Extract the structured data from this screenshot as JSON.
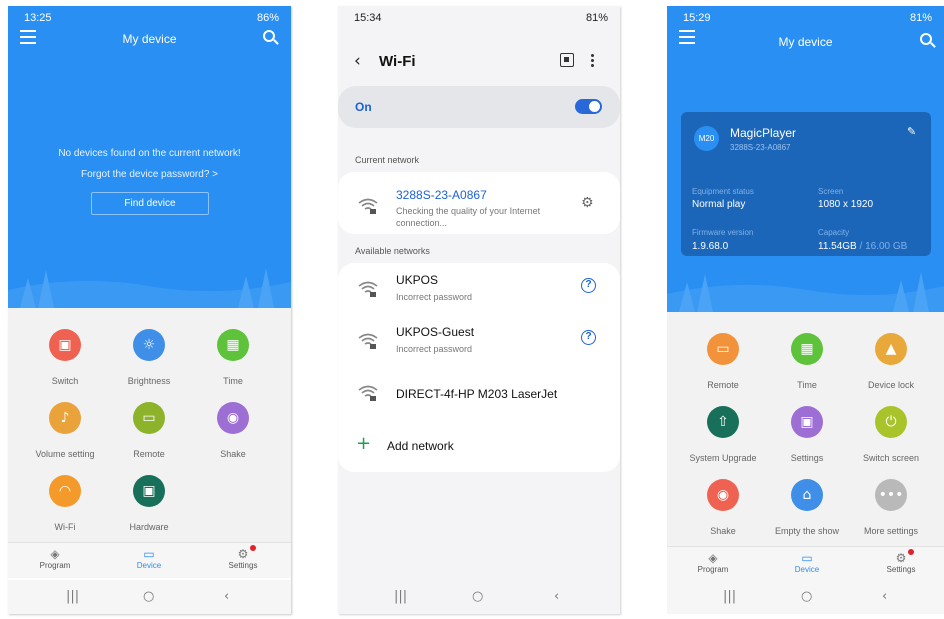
{
  "colors": {
    "accent": "#2a8ff2",
    "toggle": "#2868d8",
    "card": "#1c66b9",
    "badge": "#e0232b"
  },
  "phone1": {
    "status": {
      "time": "13:25",
      "battery": "86%"
    },
    "title": "My device",
    "message1": "No devices found on the current network!",
    "message2": "Forgot the device password? >",
    "find_button": "Find device",
    "grid": [
      {
        "label": "Switch",
        "icon": "switch-icon",
        "color": "#ef6252"
      },
      {
        "label": "Brightness",
        "icon": "brightness-icon",
        "color": "#3f8fe8"
      },
      {
        "label": "Time",
        "icon": "calendar-icon",
        "color": "#5ec23b"
      },
      {
        "label": "Volume setting",
        "icon": "volume-icon",
        "color": "#e9a33a"
      },
      {
        "label": "Remote",
        "icon": "remote-icon",
        "color": "#8db32a"
      },
      {
        "label": "Shake",
        "icon": "shake-icon",
        "color": "#9d6fd4"
      },
      {
        "label": "Wi-Fi",
        "icon": "wifi-icon",
        "color": "#f49a2a"
      },
      {
        "label": "Hardware",
        "icon": "chip-icon",
        "color": "#18705a"
      }
    ],
    "nav": {
      "program": "Program",
      "device": "Device",
      "settings": "Settings"
    }
  },
  "phone2": {
    "status": {
      "time": "15:34",
      "battery": "81%"
    },
    "title": "Wi-Fi",
    "toggle_label": "On",
    "current_header": "Current network",
    "current": {
      "name": "3288S-23-A0867",
      "status_line1": "Checking the quality of your Internet",
      "status_line2": "connection..."
    },
    "available_header": "Available networks",
    "networks": [
      {
        "name": "UKPOS",
        "status": "Incorrect password"
      },
      {
        "name": "UKPOS-Guest",
        "status": "Incorrect password"
      },
      {
        "name": "DIRECT-4f-HP M203 LaserJet",
        "status": ""
      }
    ],
    "add_network": "Add network"
  },
  "phone3": {
    "status": {
      "time": "15:29",
      "battery": "81%"
    },
    "title": "My device",
    "device": {
      "avatar": "M20",
      "name": "MagicPlayer",
      "id": "3288S-23-A0867",
      "equipment_label": "Equipment status",
      "equipment_value": "Normal play",
      "screen_label": "Screen",
      "screen_value": "1080 x 1920",
      "firmware_label": "Firmware version",
      "firmware_value": "1.9.68.0",
      "capacity_label": "Capacity",
      "capacity_used": "11.54GB",
      "capacity_total": " / 16.00 GB"
    },
    "grid": [
      {
        "label": "Remote",
        "icon": "remote-icon",
        "color": "#f2923a"
      },
      {
        "label": "Time",
        "icon": "calendar-icon",
        "color": "#5ec23b"
      },
      {
        "label": "Device lock",
        "icon": "lock-icon",
        "color": "#e9a83a"
      },
      {
        "label": "System Upgrade",
        "icon": "upgrade-icon",
        "color": "#18705a"
      },
      {
        "label": "Settings",
        "icon": "settings-grid-icon",
        "color": "#9d6fd4"
      },
      {
        "label": "Switch screen",
        "icon": "power-icon",
        "color": "#a9c42a"
      },
      {
        "label": "Shake",
        "icon": "shake-icon",
        "color": "#ef6252"
      },
      {
        "label": "Empty the show",
        "icon": "broom-icon",
        "color": "#3f8fe8"
      },
      {
        "label": "More settings",
        "icon": "more-icon",
        "color": "#b9b9b9"
      }
    ],
    "nav": {
      "program": "Program",
      "device": "Device",
      "settings": "Settings"
    }
  }
}
